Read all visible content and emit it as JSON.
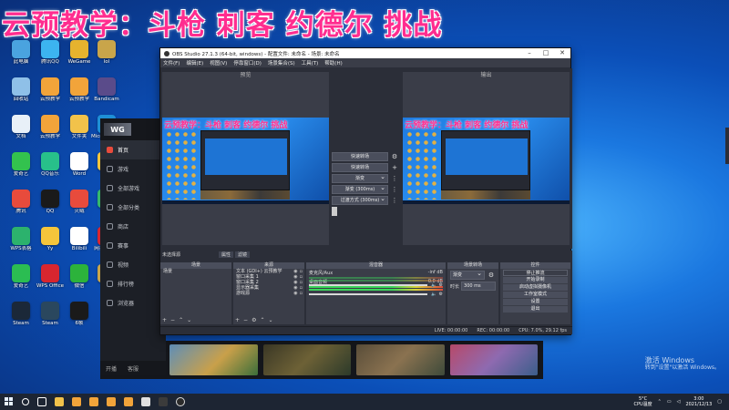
{
  "overlay_title": "云预教学：斗枪 刺客 约德尔 挑战",
  "desktop": {
    "icons": [
      {
        "label": "此电脑",
        "color": "#4aa3df"
      },
      {
        "label": "腾讯QQ",
        "color": "#3cb4f0"
      },
      {
        "label": "WeGame",
        "color": "#e6b32e"
      },
      {
        "label": "lol",
        "color": "#c9a54a"
      },
      {
        "label": "回收站",
        "color": "#8fc0e8"
      },
      {
        "label": "云预教学",
        "color": "#f2a43a"
      },
      {
        "label": "云预教学",
        "color": "#f2a43a"
      },
      {
        "label": "Bandicam",
        "color": "#5a4b8a"
      },
      {
        "label": "文档",
        "color": "#e8f0f8"
      },
      {
        "label": "云预教学",
        "color": "#f2a43a"
      },
      {
        "label": "文件夹",
        "color": "#f2c24a"
      },
      {
        "label": "Microsoft Edge",
        "color": "#1e8fd6"
      },
      {
        "label": "爱奇艺",
        "color": "#33c24e"
      },
      {
        "label": "QQ音乐",
        "color": "#28c08a"
      },
      {
        "label": "Word",
        "color": "#ffffff"
      },
      {
        "label": "WPS",
        "color": "#f5c53b"
      },
      {
        "label": "腾讯",
        "color": "#e84b3c"
      },
      {
        "label": "QQ",
        "color": "#1a1a1a"
      },
      {
        "label": "火绒",
        "color": "#e84b3c"
      },
      {
        "label": "酷狗",
        "color": "#35b86b"
      },
      {
        "label": "WPS表格",
        "color": "#2cb26d"
      },
      {
        "label": "Yy",
        "color": "#f5c53b"
      },
      {
        "label": "Bilibili",
        "color": "#ffffff"
      },
      {
        "label": "网易云音乐",
        "color": "#d8262f"
      },
      {
        "label": "爱奇艺",
        "color": "#2bbd52"
      },
      {
        "label": "WPS Office",
        "color": "#d8262f"
      },
      {
        "label": "微信",
        "color": "#2cb33b"
      },
      {
        "label": "LOL",
        "color": "#c9a54a"
      },
      {
        "label": "Steam",
        "color": "#1b2838"
      },
      {
        "label": "Steam",
        "color": "#2a475e"
      },
      {
        "label": "6帧",
        "color": "#1a1a1a"
      }
    ]
  },
  "launcher": {
    "logo": "WG",
    "items": [
      {
        "label": "首页",
        "active": true
      },
      {
        "label": "游戏"
      },
      {
        "label": "全部游戏"
      },
      {
        "label": "全部分类"
      },
      {
        "label": "商店"
      },
      {
        "label": "赛事"
      },
      {
        "label": "视频"
      },
      {
        "label": "排行榜"
      },
      {
        "label": "浏览器"
      }
    ],
    "bottom": [
      "开播",
      "客服"
    ]
  },
  "obs": {
    "title": "OBS Studio 27.1.3 (64-bit, windows) - 配置文件: 未命名 - 场景: 未命名",
    "menu": [
      "文件(F)",
      "编辑(E)",
      "视图(V)",
      "停靠窗口(D)",
      "场景集合(S)",
      "工具(T)",
      "帮助(H)"
    ],
    "preview_label": "预览",
    "program_label": "输出",
    "screen_title": "云预教学：斗枪 刺客 约德尔 挑战",
    "transition": {
      "quick": "快速转场",
      "label": "快速转场",
      "fade": "渐变",
      "duration": "渐变 (300ms)",
      "cut": "过渡方式 (300ms)"
    },
    "docks_header": "未选择源",
    "filters": [
      "属性",
      "滤镜"
    ],
    "scenes": {
      "title": "场景",
      "items": [
        "场景"
      ]
    },
    "sources": {
      "title": "来源",
      "items": [
        "文本 (GDI+) 云预教学",
        "窗口采集 1",
        "窗口采集 2",
        "显示器采集",
        "游戏源"
      ]
    },
    "mixer": {
      "title": "混音器",
      "channels": [
        {
          "name": "麦克风/Aux",
          "db": "-inf dB"
        },
        {
          "name": "桌面音频",
          "db": "0.0 dB"
        }
      ]
    },
    "transitions_dock": {
      "title": "场景转场",
      "fade": "渐变",
      "duration_label": "时长",
      "duration": "300 ms"
    },
    "controls": {
      "title": "控件",
      "buttons": [
        "停止推流",
        "开始录制",
        "启动虚拟摄像机",
        "工作室模式",
        "设置",
        "退出"
      ]
    },
    "status": [
      "LIVE: 00:00:00",
      "REC: 00:00:00",
      "CPU: 7.0%, 29.12 fps"
    ]
  },
  "taskbar": {
    "weather": [
      "5°C",
      "CPU温度"
    ],
    "time": "3:00",
    "date": "2021/12/13"
  },
  "watermark": {
    "line1": "激活 Windows",
    "line2": "转到\"设置\"以激活 Windows。"
  }
}
